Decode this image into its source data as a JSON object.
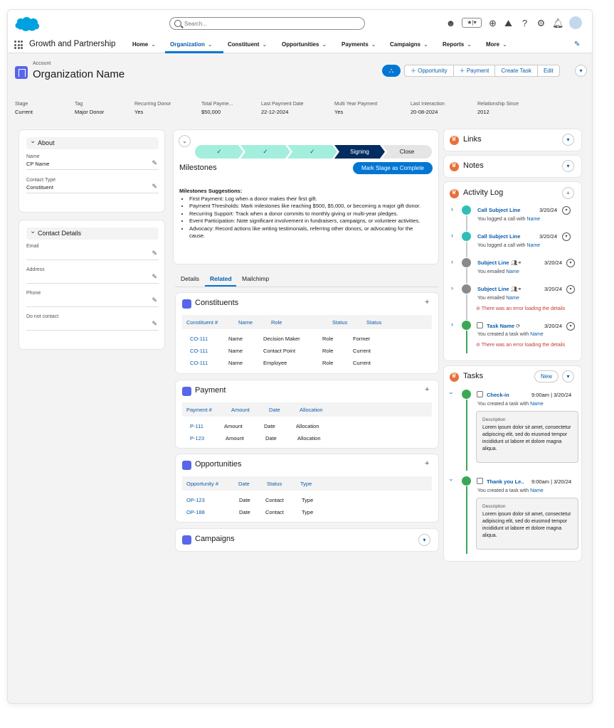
{
  "header": {
    "search_placeholder": "Search...",
    "app_name": "Growth and Partnership",
    "nav": [
      {
        "label": "Home"
      },
      {
        "label": "Organization"
      },
      {
        "label": "Constituent"
      },
      {
        "label": "Opportunities"
      },
      {
        "label": "Payments"
      },
      {
        "label": "Campaigns"
      },
      {
        "label": "Reports"
      },
      {
        "label": "More"
      }
    ]
  },
  "record": {
    "object_label": "Account",
    "name": "Organization Name",
    "actions": {
      "opportunity": "Opportunity",
      "payment": "Payment",
      "create_task": "Create Task",
      "edit": "Edit"
    },
    "highlights": [
      {
        "label": "Stage",
        "value": "Current"
      },
      {
        "label": "Tag",
        "value": "Major Donor"
      },
      {
        "label": "Recurring Donor",
        "value": "Yes"
      },
      {
        "label": "Total Payme...",
        "value": "$50,000"
      },
      {
        "label": "Last Payment Date",
        "value": "22-12-2024"
      },
      {
        "label": "Multi Year Payment",
        "value": "Yes"
      },
      {
        "label": "Last Interaction",
        "value": "20-08-2024"
      },
      {
        "label": "Relationship Since",
        "value": "2012"
      }
    ]
  },
  "about": {
    "title": "About",
    "fields": [
      {
        "label": "Name",
        "value": "CP Name"
      },
      {
        "label": "Contact Type",
        "value": "Constituent"
      }
    ]
  },
  "contact_details": {
    "title": "Contact Details",
    "fields": [
      {
        "label": "Email",
        "value": ""
      },
      {
        "label": "Address",
        "value": ""
      },
      {
        "label": "Phone",
        "value": ""
      },
      {
        "label": "Do not contact",
        "value": ""
      }
    ]
  },
  "path": {
    "current": "Signing",
    "next": "Close",
    "title": "Milestones",
    "mark_button": "Mark Stage as Complete",
    "suggestions_title": "Milestones Suggestions:",
    "suggestions": [
      "First Payment: Log when a donor makes their first gift.",
      "Payment Thresholds: Mark milestones like reaching $500, $5,000, or becoming a major gift donor.",
      "Recurring Support: Track when a donor commits to monthly giving or multi-year pledges.",
      "Event Participation: Note significant involvement in fundraisers, campaigns, or volunteer activities.",
      "Advocacy: Record actions like writing testimonials, referring other donors, or advocating for the cause."
    ]
  },
  "tabs": [
    "Details",
    "Related",
    "Mailchimp"
  ],
  "constituents": {
    "title": "Constituents",
    "columns": [
      "Constituent #",
      "Name",
      "Role",
      "Status",
      "Status"
    ],
    "rows": [
      [
        "CO-111",
        "Name",
        "Decision Maker",
        "Role",
        "Former"
      ],
      [
        "CO-111",
        "Name",
        "Contact Point",
        "Role",
        "Current"
      ],
      [
        "CO-111",
        "Name",
        "Employee",
        "Role",
        "Current"
      ]
    ]
  },
  "payment": {
    "title": "Payment",
    "columns": [
      "Payment #",
      "Amount",
      "Date",
      "Allocation"
    ],
    "rows": [
      [
        "P-111",
        "Amount",
        "Date",
        "Allocation"
      ],
      [
        "P-123",
        "Amount",
        "Date",
        "Allocation"
      ]
    ]
  },
  "opportunities": {
    "title": "Opportunities",
    "columns": [
      "Opportunity #",
      "Date",
      "Status",
      "Type"
    ],
    "rows": [
      [
        "OP-123",
        "Date",
        "Contact",
        "Type"
      ],
      [
        "OP-188",
        "Date",
        "Contact",
        "Type"
      ]
    ]
  },
  "campaigns": {
    "title": "Campaigns"
  },
  "links": {
    "title": "Links"
  },
  "notes": {
    "title": "Notes"
  },
  "activity": {
    "title": "Activity Log",
    "items": [
      {
        "title": "Call Subject Line",
        "date": "3/20/24",
        "sub_prefix": "You logged a call with",
        "sub_link": "Name",
        "error": ""
      },
      {
        "title": "Call Subject Line",
        "date": "3/20/24",
        "sub_prefix": "You logged a call with",
        "sub_link": "Name",
        "error": ""
      },
      {
        "title": "Subject Line",
        "date": "3/20/24",
        "sub_prefix": "You emailed",
        "sub_link": "Name",
        "error": ""
      },
      {
        "title": "Subject Line",
        "date": "3/20/24",
        "sub_prefix": "You emailed",
        "sub_link": "Name",
        "error": "There was an error loading the details"
      },
      {
        "title": "Task Name",
        "date": "3/20/24",
        "sub_prefix": "You created a task with",
        "sub_link": "Name",
        "error": "There was an error loading the details"
      }
    ]
  },
  "tasks": {
    "title": "Tasks",
    "new_label": "New",
    "items": [
      {
        "title": "Check-in",
        "date": "9:00am | 3/20/24",
        "sub_prefix": "You created a task with",
        "sub_link": "Name",
        "desc_label": "Description",
        "desc": "Lorem ipsum dolor sit amet, consectetur adipiscing elit, sed do eiusmod tempor incididunt ut labore et dolore magna aliqua."
      },
      {
        "title": "Thank you Le..",
        "date": "9:00am | 3/20/24",
        "sub_prefix": "You created a task with",
        "sub_link": "Name",
        "desc_label": "Description",
        "desc": "Lorem ipsum dolor sit amet, consectetur adipiscing elit, sed do eiusmod tempor incididunt ut labore et dolore magna aliqua."
      }
    ]
  },
  "colors": {
    "brand": "#0176d3",
    "path_complete": "#a4eedd",
    "path_current": "#032d60",
    "activity_call": "#2ebfb8",
    "activity_email": "#8a8a8a",
    "activity_task": "#3ba755",
    "orange": "#e8703a"
  }
}
